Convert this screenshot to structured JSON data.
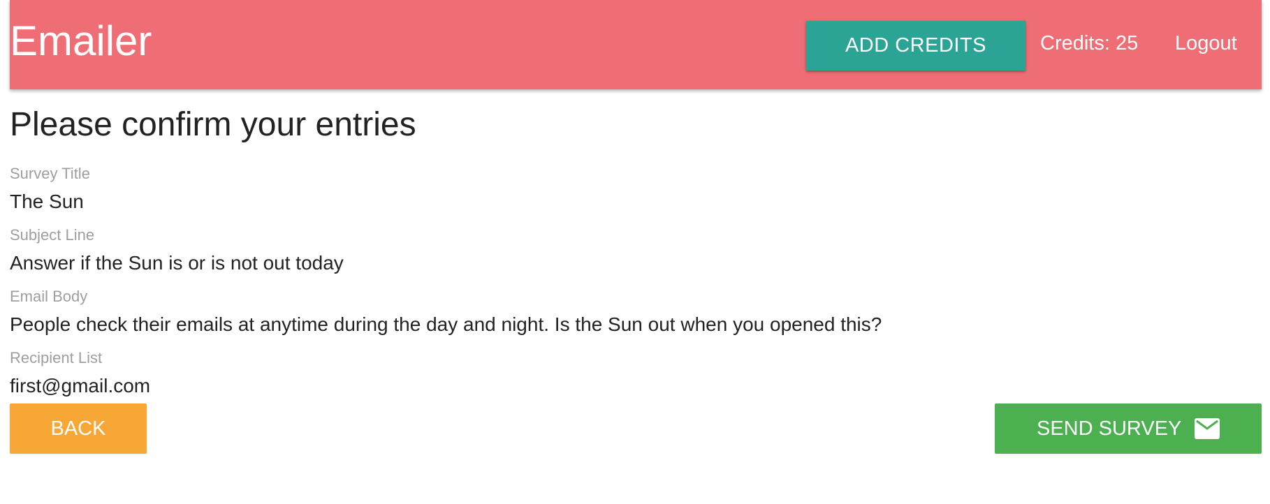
{
  "header": {
    "brand": "Emailer",
    "add_credits_label": "ADD CREDITS",
    "credits_text": "Credits: 25",
    "logout_label": "Logout"
  },
  "page": {
    "title": "Please confirm your entries"
  },
  "fields": [
    {
      "label": "Survey Title",
      "value": "The Sun"
    },
    {
      "label": "Subject Line",
      "value": "Answer if the Sun is or is not out today"
    },
    {
      "label": "Email Body",
      "value": "People check their emails at anytime during the day and night. Is the Sun out when you opened this?"
    },
    {
      "label": "Recipient List",
      "value": "first@gmail.com"
    }
  ],
  "actions": {
    "back_label": "BACK",
    "send_label": "SEND SURVEY",
    "send_icon": "mail-icon"
  },
  "colors": {
    "navbar": "#ef6e75",
    "add_credits": "#2ba496",
    "back": "#f7a736",
    "send": "#4caf50"
  }
}
